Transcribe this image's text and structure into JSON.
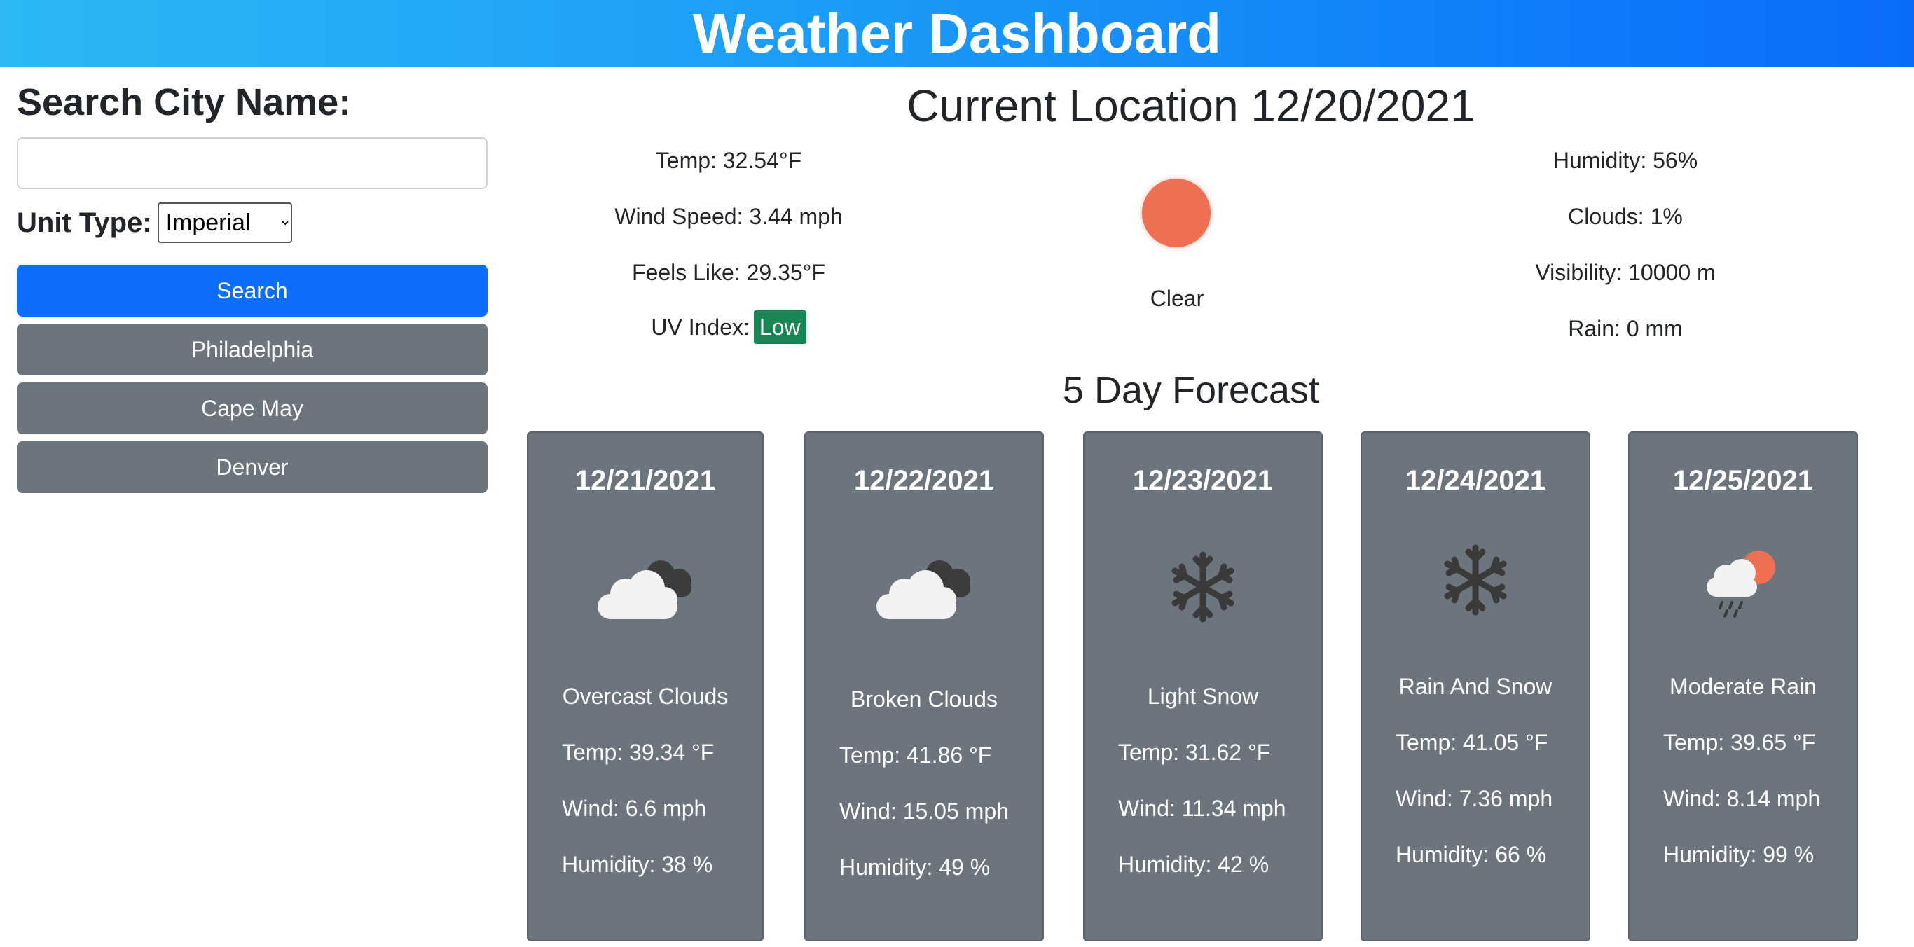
{
  "header": {
    "title": "Weather Dashboard"
  },
  "sidebar": {
    "search_label": "Search City Name:",
    "search_value": "",
    "unit_label": "Unit Type:",
    "unit_selected": "Imperial",
    "search_button": "Search",
    "history": [
      "Philadelphia",
      "Cape May",
      "Denver"
    ]
  },
  "current": {
    "title": "Current Location 12/20/2021",
    "temp": "Temp: 32.54°F",
    "wind": "Wind Speed: 3.44 mph",
    "feels": "Feels Like: 29.35°F",
    "uv_label": "UV Index:",
    "uv_value": "Low",
    "humidity": "Humidity: 56%",
    "clouds": "Clouds: 1%",
    "visibility": "Visibility: 10000 m",
    "rain": "Rain: 0 mm",
    "condition": "Clear",
    "icon": "sun-icon",
    "uv_color": "#198754"
  },
  "forecast": {
    "title": "5 Day Forecast",
    "days": [
      {
        "date": "12/21/2021",
        "icon": "overcast-clouds-icon",
        "desc": "Overcast Clouds",
        "temp": "Temp: 39.34 °F",
        "wind": "Wind: 6.6 mph",
        "humidity": "Humidity: 38 %"
      },
      {
        "date": "12/22/2021",
        "icon": "broken-clouds-icon",
        "desc": "Broken Clouds",
        "temp": "Temp: 41.86 °F",
        "wind": "Wind: 15.05 mph",
        "humidity": "Humidity: 49 %"
      },
      {
        "date": "12/23/2021",
        "icon": "snowflake-icon",
        "desc": "Light Snow",
        "temp": "Temp: 31.62 °F",
        "wind": "Wind: 11.34 mph",
        "humidity": "Humidity: 42 %"
      },
      {
        "date": "12/24/2021",
        "icon": "snowflake-icon",
        "desc": "Rain And Snow",
        "temp": "Temp: 41.05 °F",
        "wind": "Wind: 7.36 mph",
        "humidity": "Humidity: 66 %"
      },
      {
        "date": "12/25/2021",
        "icon": "sun-rain-cloud-icon",
        "desc": "Moderate Rain",
        "temp": "Temp: 39.65 °F",
        "wind": "Wind: 8.14 mph",
        "humidity": "Humidity: 99 %"
      }
    ]
  },
  "colors": {
    "header_start": "#2bb8f5",
    "header_end": "#0b6cfb",
    "primary": "#0d6efd",
    "secondary": "#6c757d",
    "sun": "#ee7052"
  }
}
